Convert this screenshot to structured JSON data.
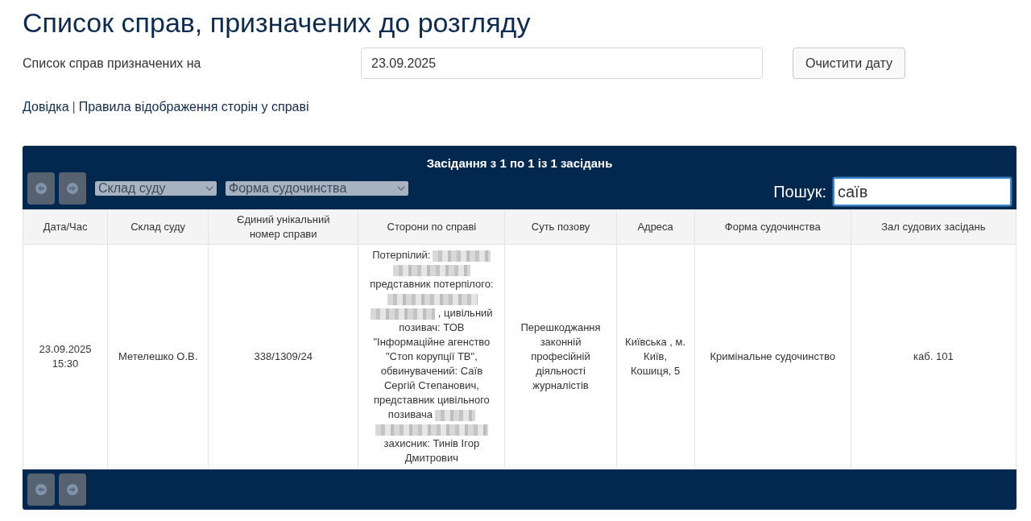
{
  "page_title": "Список справ, призначених до розгляду",
  "date_filter": {
    "label": "Список справ призначених на",
    "value": "23.09.2025",
    "clear_button": "Очистити дату"
  },
  "links": [
    {
      "label": "Довідка"
    },
    {
      "label": "Правила відображення сторін у справі"
    }
  ],
  "links_separator": "|",
  "table_panel": {
    "caption": "Засідання з 1 по 1 із 1 засідань",
    "pager_top": [
      {
        "kind": "prev",
        "disabled": true
      },
      {
        "kind": "next",
        "disabled": true
      }
    ],
    "filters": [
      {
        "value": "Склад суду"
      },
      {
        "value": "Форма судочинства"
      }
    ],
    "search": {
      "label": "Пошук:",
      "value": "саїв",
      "focused": true
    },
    "columns": [
      "Дата/Час",
      "Склад суду",
      "Єдиний унікальний номер справи",
      "Сторони по справі",
      "Суть позову",
      "Адреса",
      "Форма судочинства",
      "Зал судових засідань"
    ],
    "rows": [
      {
        "datetime": "23.09.2025 15:30",
        "judge": "Метелешко О.В.",
        "case_number": "338/1309/24",
        "parties": [
          {
            "kind": "text",
            "text": "Потерпілий:"
          },
          {
            "kind": "redacted"
          },
          {
            "kind": "text",
            "text": "представник потерпілого:"
          },
          {
            "kind": "redacted"
          },
          {
            "kind": "text",
            "text": ", цивільний позивач: ТОВ \"Інформаційне агенство \"Стоп корупції ТВ\", обвинувачений: Саїв Сергій Степанович, представник цивільного позивача"
          },
          {
            "kind": "redacted"
          },
          {
            "kind": "text",
            "text": "захисник: Тинів Ігор Дмитрович"
          }
        ],
        "claim": "Перешкоджання законній професійній діяльності журналістів",
        "address": "Київська , м. Київ, Кошиця, 5",
        "proceeding_form": "Кримінальне судочинство",
        "courtroom": "каб. 101"
      }
    ],
    "pager_bottom": [
      {
        "kind": "prev",
        "disabled": true
      },
      {
        "kind": "next",
        "disabled": true
      }
    ]
  }
}
